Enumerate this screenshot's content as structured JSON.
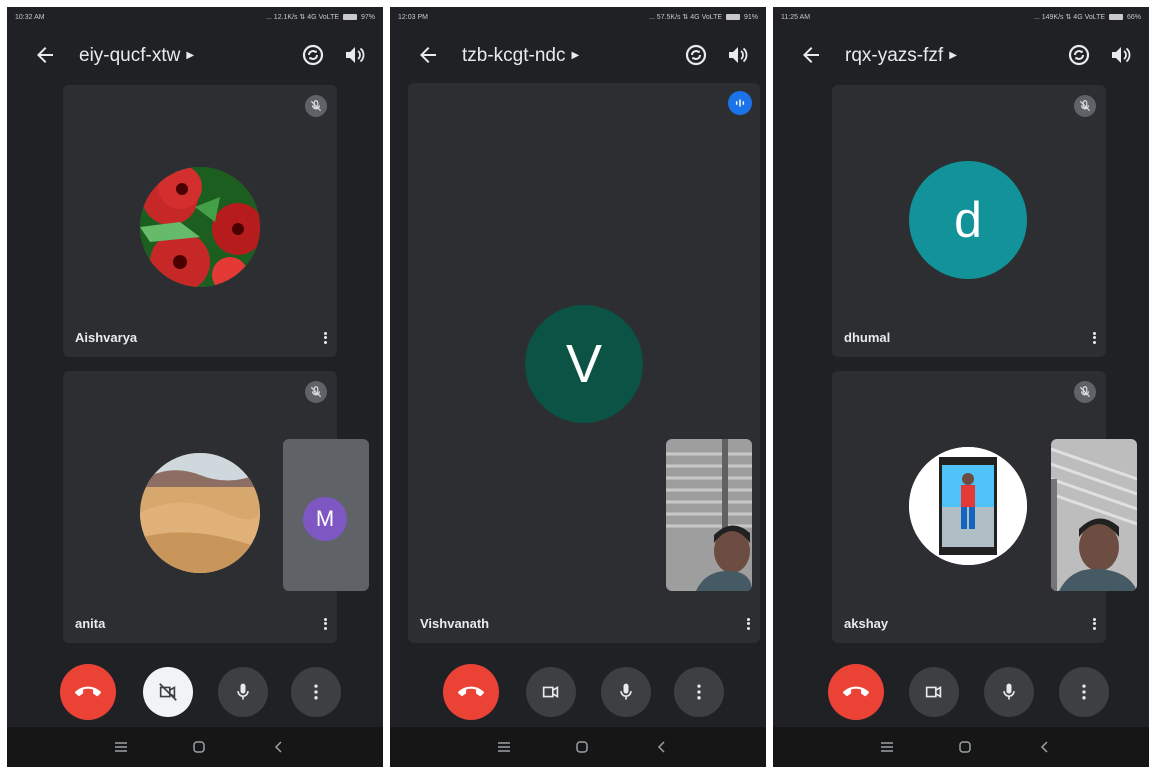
{
  "colors": {
    "background": "#202124",
    "tile": "#2d2e31",
    "end_call": "#ea4335",
    "control": "#3c4043",
    "avatar_m": "#7e57c2",
    "avatar_v": "#0b5345",
    "avatar_d": "#12939a",
    "speaking": "#1a73e8"
  },
  "phones": [
    {
      "status": {
        "time": "10:32 AM",
        "info": "... 12.1K/s ⇅ 4G VoLTE",
        "battery": "97%"
      },
      "meeting_code": "eiy-qucf-xtw",
      "participants": [
        {
          "name": "Aishvarya",
          "avatar": "flower-photo",
          "muted": true
        },
        {
          "name": "anita",
          "avatar": "desert-photo",
          "muted": true
        }
      ],
      "self_tile": {
        "initial": "M"
      },
      "camera_off": true,
      "controls": [
        "end-call",
        "camera-off",
        "mic",
        "more"
      ]
    },
    {
      "status": {
        "time": "12:03 PM",
        "info": "... 57.5K/s ⇅ 4G VoLTE",
        "battery": "91%"
      },
      "meeting_code": "tzb-kcgt-ndc",
      "participants": [
        {
          "name": "Vishvanath",
          "initial": "V",
          "speaking": true
        }
      ],
      "self_tile": {
        "type": "camera-photo"
      },
      "camera_off": false,
      "controls": [
        "end-call",
        "camera",
        "mic",
        "more"
      ]
    },
    {
      "status": {
        "time": "11:25 AM",
        "info": "... 149K/s ⇅ 4G VoLTE",
        "battery": "66%"
      },
      "meeting_code": "rqx-yazs-fzf",
      "participants": [
        {
          "name": "dhumal",
          "initial": "d",
          "muted": true
        },
        {
          "name": "akshay",
          "avatar": "person-photo",
          "muted": true
        }
      ],
      "self_tile": {
        "type": "camera-photo"
      },
      "camera_off": false,
      "controls": [
        "end-call",
        "camera",
        "mic",
        "more"
      ]
    }
  ]
}
